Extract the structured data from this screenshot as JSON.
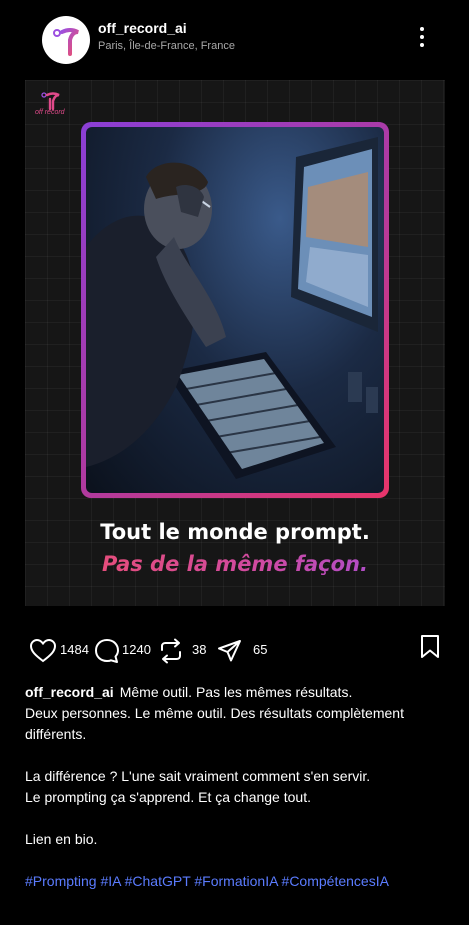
{
  "post": {
    "username": "off_record_ai",
    "location": "Paris, Île-de-France, France",
    "image": {
      "brand_label": "off record",
      "headline_line1": "Tout le monde prompt.",
      "headline_line2": "Pas de la même façon."
    },
    "actions": {
      "likes": "1484",
      "comments": "1240",
      "reposts": "38",
      "shares": "65"
    },
    "caption": {
      "username": "off_record_ai",
      "line1": "Même outil. Pas les mêmes résultats.",
      "line2": "Deux personnes. Le même outil. Des résultats complètement différents.",
      "line3": "La différence ? L'une sait vraiment comment s'en servir.",
      "line4": "Le prompting ça s'apprend. Et ça change tout.",
      "line5": "Lien en bio.",
      "hashtags": "#Prompting #IA #ChatGPT #FormationIA #CompétencesIA"
    }
  }
}
